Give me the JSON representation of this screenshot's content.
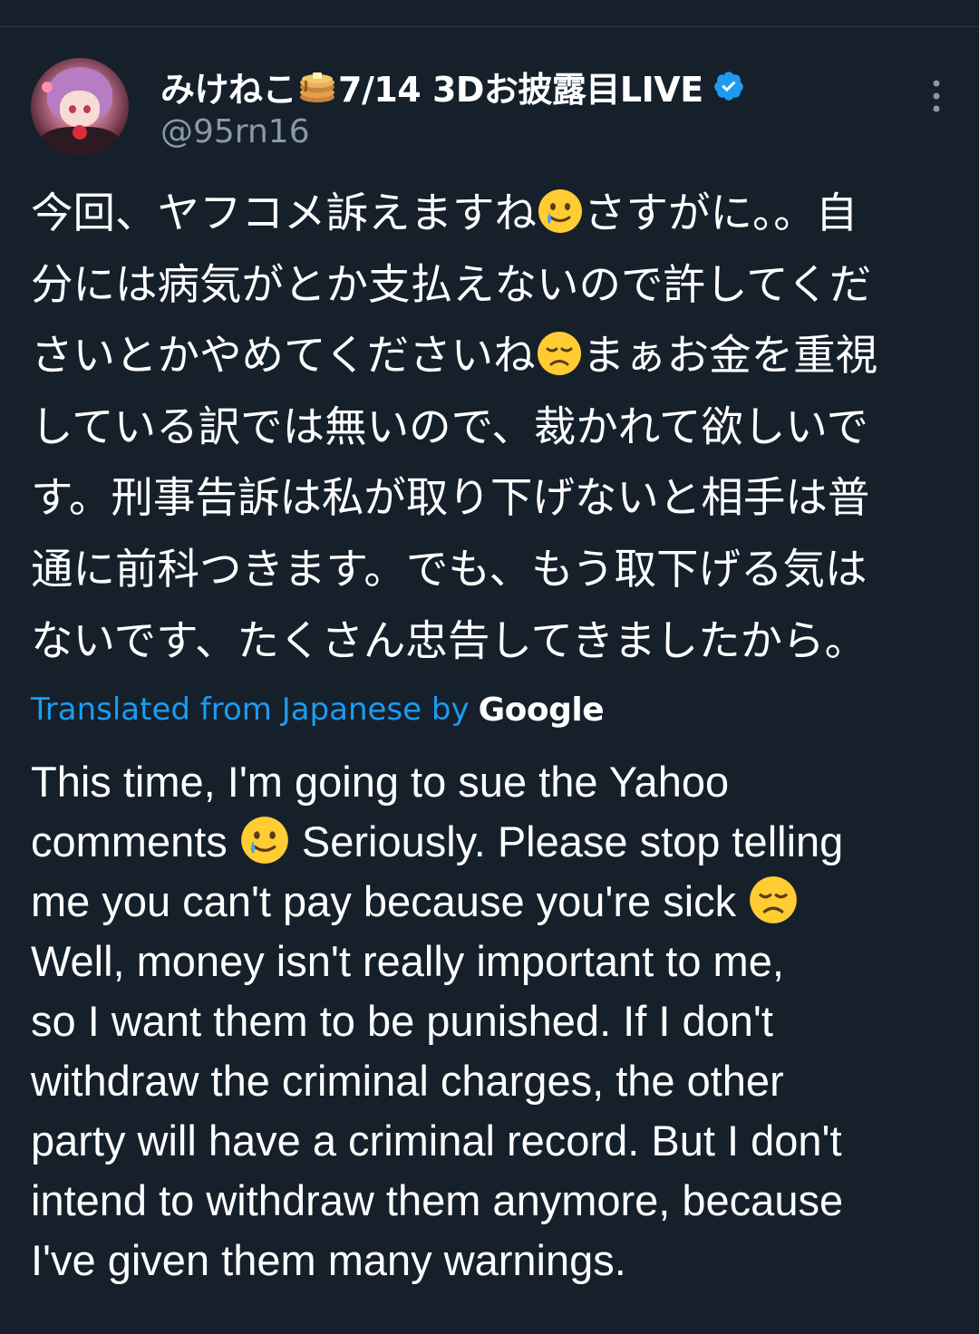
{
  "header": {
    "display_name_part1": "みけねこ",
    "display_name_part2": "7/14 3Dお披露目LIVE",
    "handle": "@95rn16",
    "pancake_icon": "pancakes-emoji",
    "verified_icon": "verified-badge-icon",
    "more_icon": "more-vertical-icon"
  },
  "tweet": {
    "japanese_lines": [
      {
        "a": "今回、ヤフコメ訴えますね",
        "emoji": "smiling-face-with-tear-emoji",
        "b": "さすがに。。自"
      },
      {
        "a": "分には病気がとか支払えないので許してくだ"
      },
      {
        "a": "さいとかやめてくださいね",
        "emoji": "disappointed-face-emoji",
        "b": "まぁお金を重視"
      },
      {
        "a": "している訳では無いので、裁かれて欲しいで"
      },
      {
        "a": "す。刑事告訴は私が取り下げないと相手は普"
      },
      {
        "a": "通に前科つきます。でも、もう取下げる気は"
      },
      {
        "a": "ないです、たくさん忠告してきましたから。"
      }
    ],
    "translation_label": "Translated from Japanese by",
    "translation_provider": "Google",
    "english_lines": [
      {
        "a": "This time, I'm going to sue the Yahoo"
      },
      {
        "a": "comments ",
        "emoji": "smiling-face-with-tear-emoji",
        "b": " Seriously. Please stop telling"
      },
      {
        "a": "me you can't pay because you're sick ",
        "emoji": "disappointed-face-emoji"
      },
      {
        "a": "Well, money isn't really important to me,"
      },
      {
        "a": "so I want them to be punished. If I don't"
      },
      {
        "a": "withdraw the criminal charges, the other"
      },
      {
        "a": "party will have a criminal record. But I don't"
      },
      {
        "a": "intend to withdraw them anymore, because"
      },
      {
        "a": "I've given them many warnings."
      }
    ]
  },
  "colors": {
    "background": "#15202b",
    "text": "#ffffff",
    "secondary_text": "#8b98a5",
    "link": "#1d9bf0",
    "verified": "#1d9bf0"
  }
}
